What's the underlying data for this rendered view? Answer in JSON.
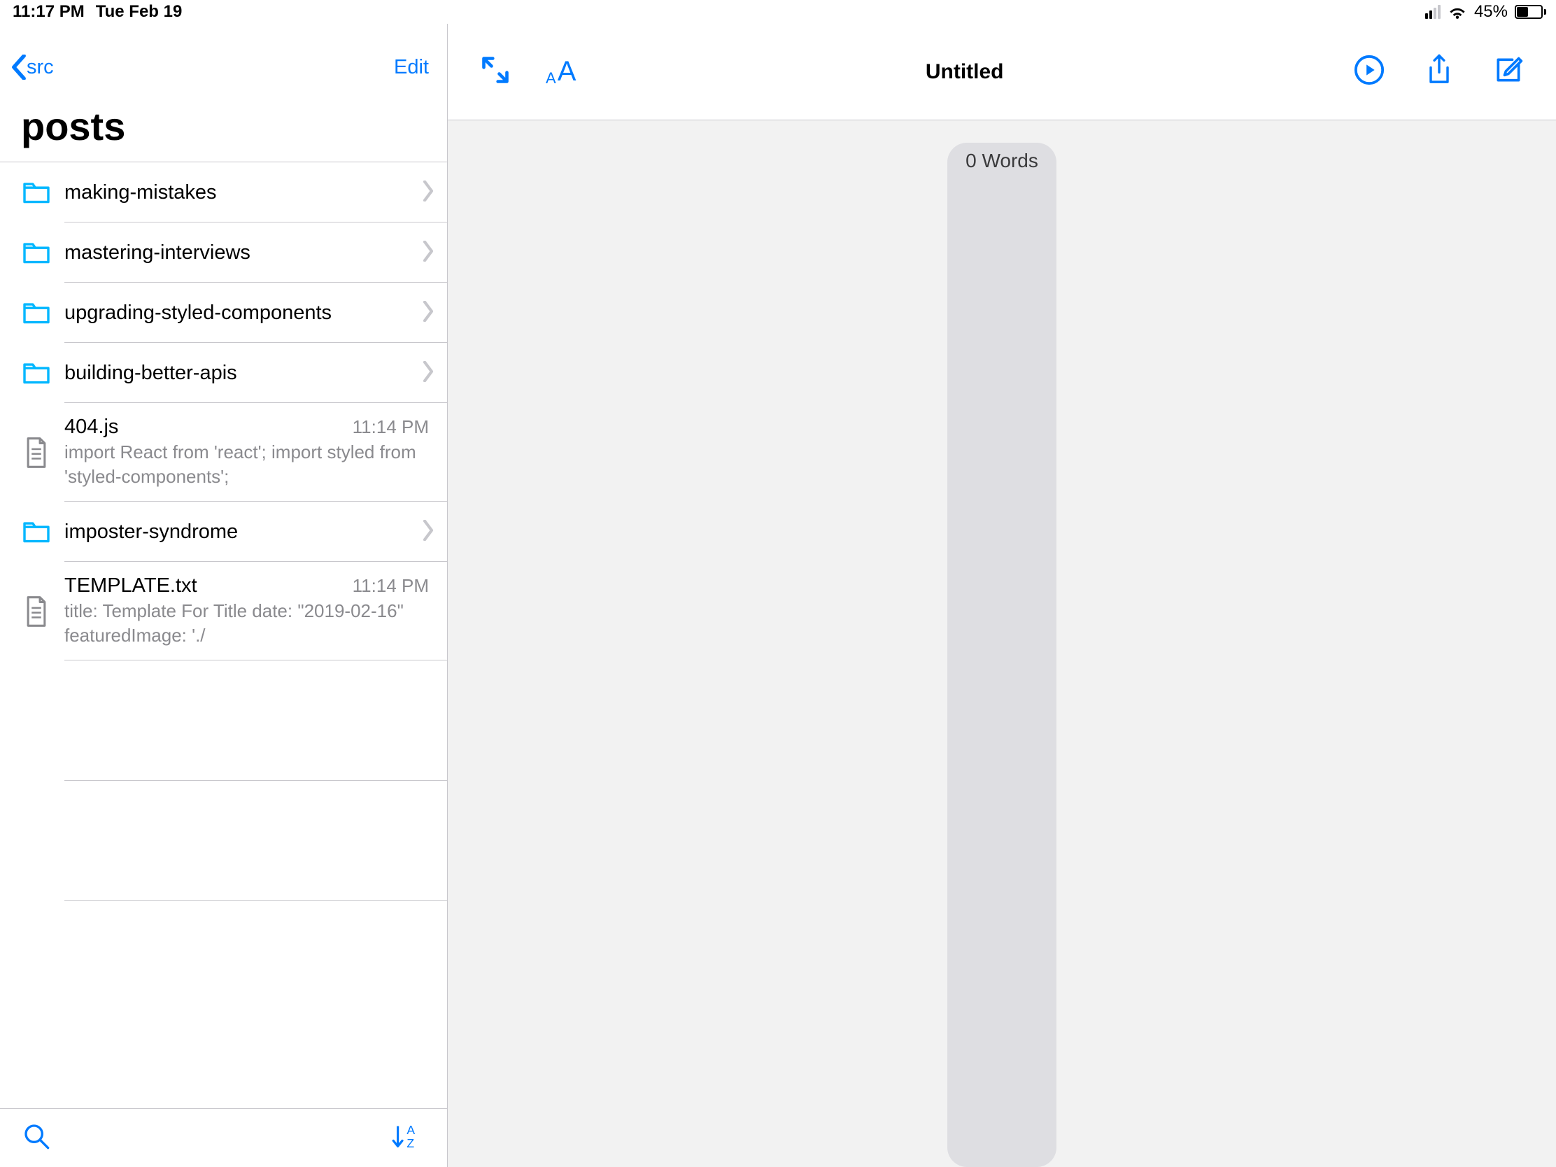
{
  "status": {
    "time": "11:17 PM",
    "date": "Tue Feb 19",
    "battery_pct": "45%"
  },
  "sidebar": {
    "back_label": "src",
    "edit_label": "Edit",
    "title": "posts",
    "items": [
      {
        "type": "folder",
        "name": "making-mistakes"
      },
      {
        "type": "folder",
        "name": "mastering-interviews"
      },
      {
        "type": "folder",
        "name": "upgrading-styled-components"
      },
      {
        "type": "folder",
        "name": "building-better-apis"
      },
      {
        "type": "file",
        "name": "404.js",
        "time": "11:14 PM",
        "preview": "import React from 'react'; import styled from 'styled-components';"
      },
      {
        "type": "folder",
        "name": "imposter-syndrome"
      },
      {
        "type": "file",
        "name": "TEMPLATE.txt",
        "time": "11:14 PM",
        "preview": "title: Template For Title date: \"2019-02-16\" featuredImage: './"
      }
    ]
  },
  "editor": {
    "title": "Untitled",
    "word_count_label": "0 Words"
  },
  "colors": {
    "accent": "#007aff",
    "divider": "#c8c7cc",
    "muted": "#8a8a8e",
    "editor_bg": "#f2f2f2"
  }
}
